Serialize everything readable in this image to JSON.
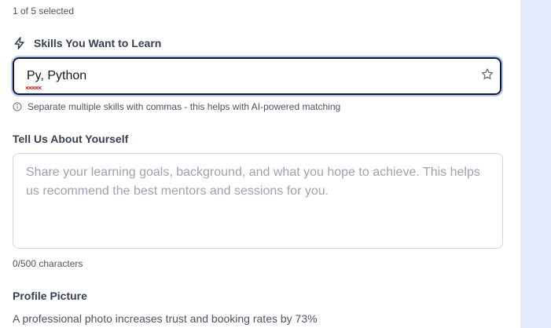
{
  "selection": {
    "count_text": "1 of 5 selected"
  },
  "skills": {
    "label": "Skills You Want to Learn",
    "value": "Py, Python",
    "hint": "Separate multiple skills with commas - this helps with AI-powered matching",
    "icon": "lightning-icon",
    "trailing_icon": "star-icon"
  },
  "about": {
    "label": "Tell Us About Yourself",
    "placeholder": "Share your learning goals, background, and what you hope to achieve. This helps us recommend the best mentors and sessions for you.",
    "value": "",
    "character_count": "0/500 characters"
  },
  "profile_picture": {
    "label": "Profile Picture",
    "description": "A professional photo increases trust and booking rates by 73%"
  },
  "colors": {
    "focus_border": "#111827",
    "focus_ring": "#b5c5ff",
    "right_panel": "#e5e9ff",
    "placeholder": "#9ca3af",
    "spellcheck": "#dc2626"
  }
}
